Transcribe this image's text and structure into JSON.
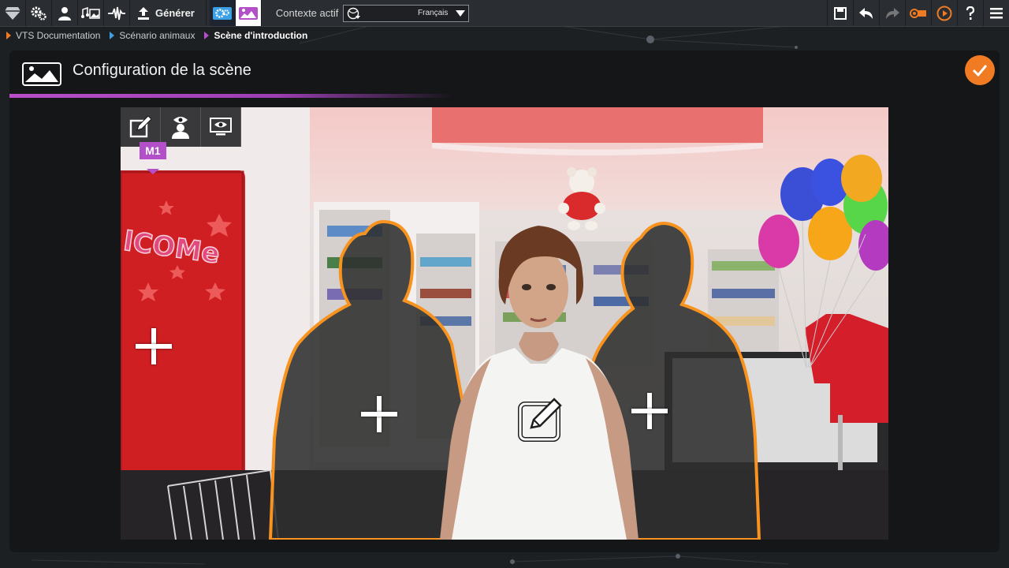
{
  "toolbar": {
    "generate_label": "Générer",
    "context_label": "Contexte actif",
    "context_value": "Français",
    "colors": {
      "accent": "#f07b22",
      "active_blue": "#3ba0e6",
      "purple": "#b34fc9"
    }
  },
  "breadcrumb": {
    "items": [
      {
        "label": "VTS Documentation",
        "color": "#f07b22"
      },
      {
        "label": "Scénario animaux",
        "color": "#3ba0e6"
      },
      {
        "label": "Scène d'introduction",
        "color": "#b34fc9"
      }
    ]
  },
  "panel": {
    "title": "Configuration de la scène"
  },
  "scene": {
    "marker_label": "M1",
    "icons": [
      "edit-icon",
      "character-view-icon",
      "screen-view-icon"
    ]
  }
}
